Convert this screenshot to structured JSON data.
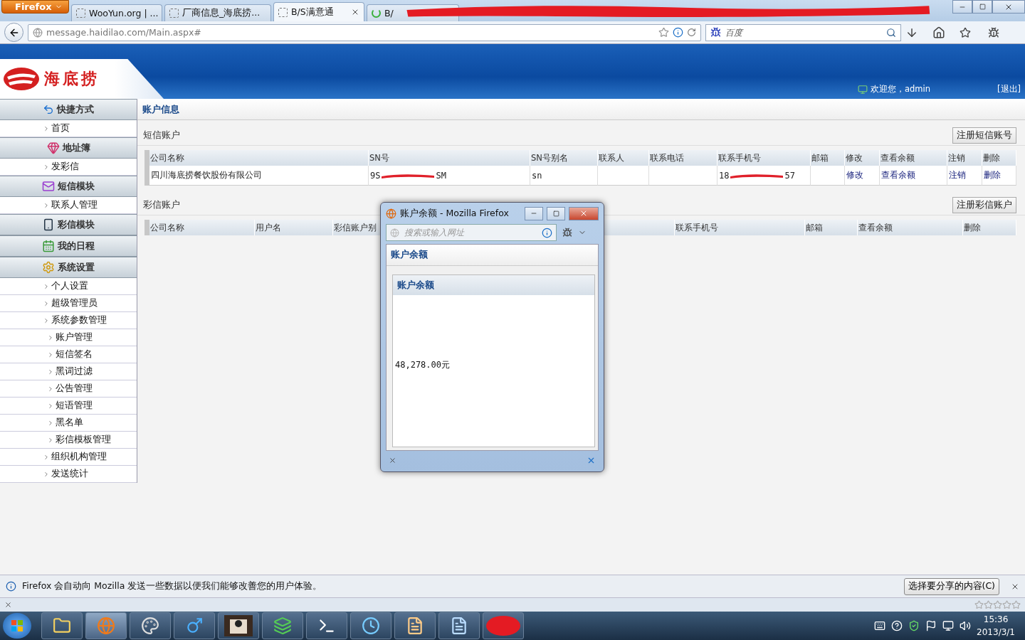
{
  "browser": {
    "menu_button": "Firefox",
    "url": "message.haidilao.com/Main.aspx#",
    "search_placeholder": "百度",
    "tabs": [
      {
        "title": "WooYun.org | ...",
        "selected": false,
        "kind": "page"
      },
      {
        "title": "厂商信息_海底捞...",
        "selected": false,
        "kind": "page"
      },
      {
        "title": "B/S满意通",
        "selected": true,
        "kind": "page"
      },
      {
        "title": "B/",
        "selected": false,
        "kind": "loading"
      }
    ]
  },
  "header": {
    "logo": "海底捞",
    "welcome": "欢迎您，admin",
    "logout": "[退出]"
  },
  "sidebar": [
    {
      "label": "快捷方式",
      "children": [
        {
          "label": "首页"
        }
      ]
    },
    {
      "label": "地址簿",
      "children": [
        {
          "label": "发彩信"
        }
      ]
    },
    {
      "label": "短信模块",
      "children": [
        {
          "label": "联系人管理"
        }
      ]
    },
    {
      "label": "彩信模块"
    },
    {
      "label": "我的日程"
    },
    {
      "label": "系统设置",
      "children": [
        {
          "label": "个人设置"
        },
        {
          "label": "超级管理员"
        },
        {
          "label": "系统参数管理",
          "children": [
            {
              "label": "账户管理"
            },
            {
              "label": "短信签名"
            },
            {
              "label": "黑词过滤"
            },
            {
              "label": "公告管理"
            },
            {
              "label": "短语管理"
            },
            {
              "label": "黑名单"
            },
            {
              "label": "彩信模板管理"
            }
          ]
        },
        {
          "label": "组织机构管理"
        },
        {
          "label": "发送统计"
        }
      ]
    }
  ],
  "content": {
    "title": "账户信息",
    "sections": [
      {
        "title": "短信账户",
        "button": "注册短信账号",
        "columns": [
          "公司名称",
          "SN号",
          "SN号别名",
          "联系人",
          "联系电话",
          "联系手机号",
          "邮箱",
          "修改",
          "查看余额",
          "注销",
          "删除"
        ],
        "rows": [
          [
            {
              "kind": "text",
              "text": "四川海底捞餐饮股份有限公司"
            },
            {
              "kind": "redacted",
              "start": "9S",
              "end": "SM"
            },
            {
              "kind": "mono",
              "text": "sn"
            },
            {
              "kind": "empty"
            },
            {
              "kind": "empty"
            },
            {
              "kind": "redacted",
              "start": "18",
              "end": "57"
            },
            {
              "kind": "empty"
            },
            {
              "kind": "link",
              "text": "修改"
            },
            {
              "kind": "link",
              "text": "查看余额"
            },
            {
              "kind": "link",
              "text": "注销"
            },
            {
              "kind": "link",
              "text": "删除"
            }
          ]
        ]
      },
      {
        "title": "彩信账户",
        "button": "注册彩信账户",
        "columns": [
          "公司名称",
          "用户名",
          "彩信账户别",
          "联系手机号",
          "邮箱",
          "查看余额",
          "删除"
        ]
      }
    ]
  },
  "popup": {
    "title": "账户余额 - Mozilla Firefox",
    "url_placeholder": "搜索或输入网址",
    "page_title": "账户余额",
    "panel_title": "账户余额",
    "balance": "48,278.00元"
  },
  "notification": {
    "text": "Firefox 会自动向 Mozilla 发送一些数据以便我们能够改善您的用户体验。",
    "button": "选择要分享的内容(C)"
  },
  "taskbar": {
    "time": "15:36",
    "date": "2013/3/1"
  }
}
